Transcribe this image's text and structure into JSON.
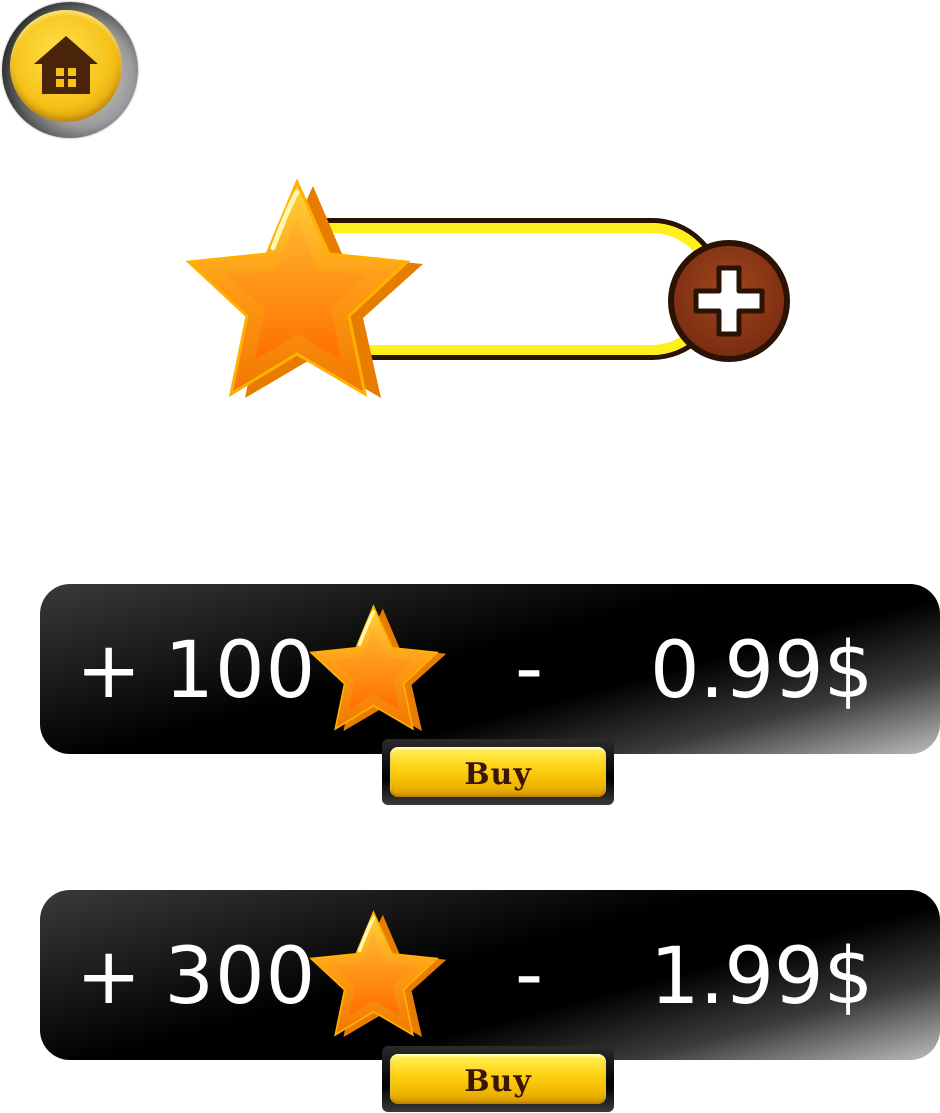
{
  "colors": {
    "gold": "#f6c21a",
    "bar_yellow": "#ffef1c",
    "brown": "#7e2f12",
    "dark": "#2a1205",
    "card_black": "#000000",
    "text_white": "#ffffff"
  },
  "home": {
    "icon": "home-icon"
  },
  "counter": {
    "icon": "star-icon",
    "value": "",
    "add_icon": "plus-icon"
  },
  "offers": [
    {
      "plus": "+",
      "amount": "100",
      "dash": "-",
      "price": "0.99$",
      "buy_label": "Buy"
    },
    {
      "plus": "+",
      "amount": "300",
      "dash": "-",
      "price": "1.99$",
      "buy_label": "Buy"
    }
  ]
}
